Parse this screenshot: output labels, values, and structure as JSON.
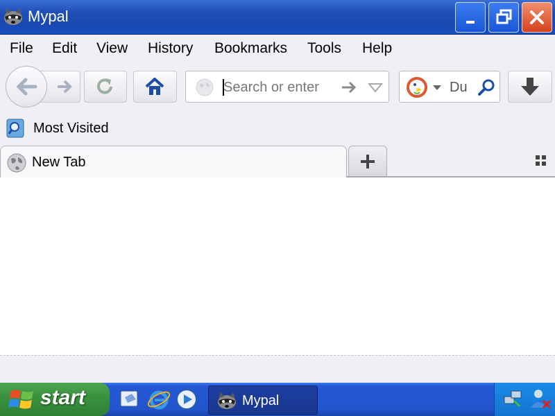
{
  "window": {
    "title": "Mypal",
    "app_icon": "raccoon-icon",
    "controls": {
      "minimize": "minimize-icon",
      "maximize": "restore-icon",
      "close": "close-icon"
    },
    "colors": {
      "titlebar": "#1f50b8",
      "close": "#d6421e"
    }
  },
  "menubar": {
    "items": [
      {
        "label": "File",
        "accel": "F"
      },
      {
        "label": "Edit",
        "accel": "E"
      },
      {
        "label": "View",
        "accel": "V"
      },
      {
        "label": "History",
        "accel": "s"
      },
      {
        "label": "Bookmarks",
        "accel": "B"
      },
      {
        "label": "Tools",
        "accel": "T"
      },
      {
        "label": "Help",
        "accel": "H"
      }
    ]
  },
  "navbar": {
    "back_icon": "back-arrow-icon",
    "forward_icon": "forward-arrow-icon",
    "reload_icon": "reload-icon",
    "home_icon": "home-icon",
    "url": {
      "value": "",
      "placeholder": "Search or enter"
    },
    "search": {
      "engine_icon": "duckduckgo-icon",
      "value": "",
      "placeholder": "Du"
    },
    "download_icon": "download-arrow-icon"
  },
  "bookmarks": {
    "items": [
      {
        "label": "Most Visited",
        "icon": "most-visited-icon"
      }
    ]
  },
  "tabs": {
    "items": [
      {
        "label": "New Tab",
        "icon": "globe-icon"
      }
    ],
    "new_tab_icon": "plus-icon",
    "list_icon": "tab-grid-icon"
  },
  "taskbar": {
    "start_label": "start",
    "quick_launch": [
      "show-desktop-icon",
      "internet-explorer-icon",
      "media-player-icon"
    ],
    "tasks": [
      {
        "label": "Mypal",
        "icon": "raccoon-icon"
      }
    ],
    "tray": [
      "network-icon",
      "user-icon"
    ],
    "colors": {
      "taskbar": "#2254cc",
      "start": "#3a9240"
    }
  }
}
